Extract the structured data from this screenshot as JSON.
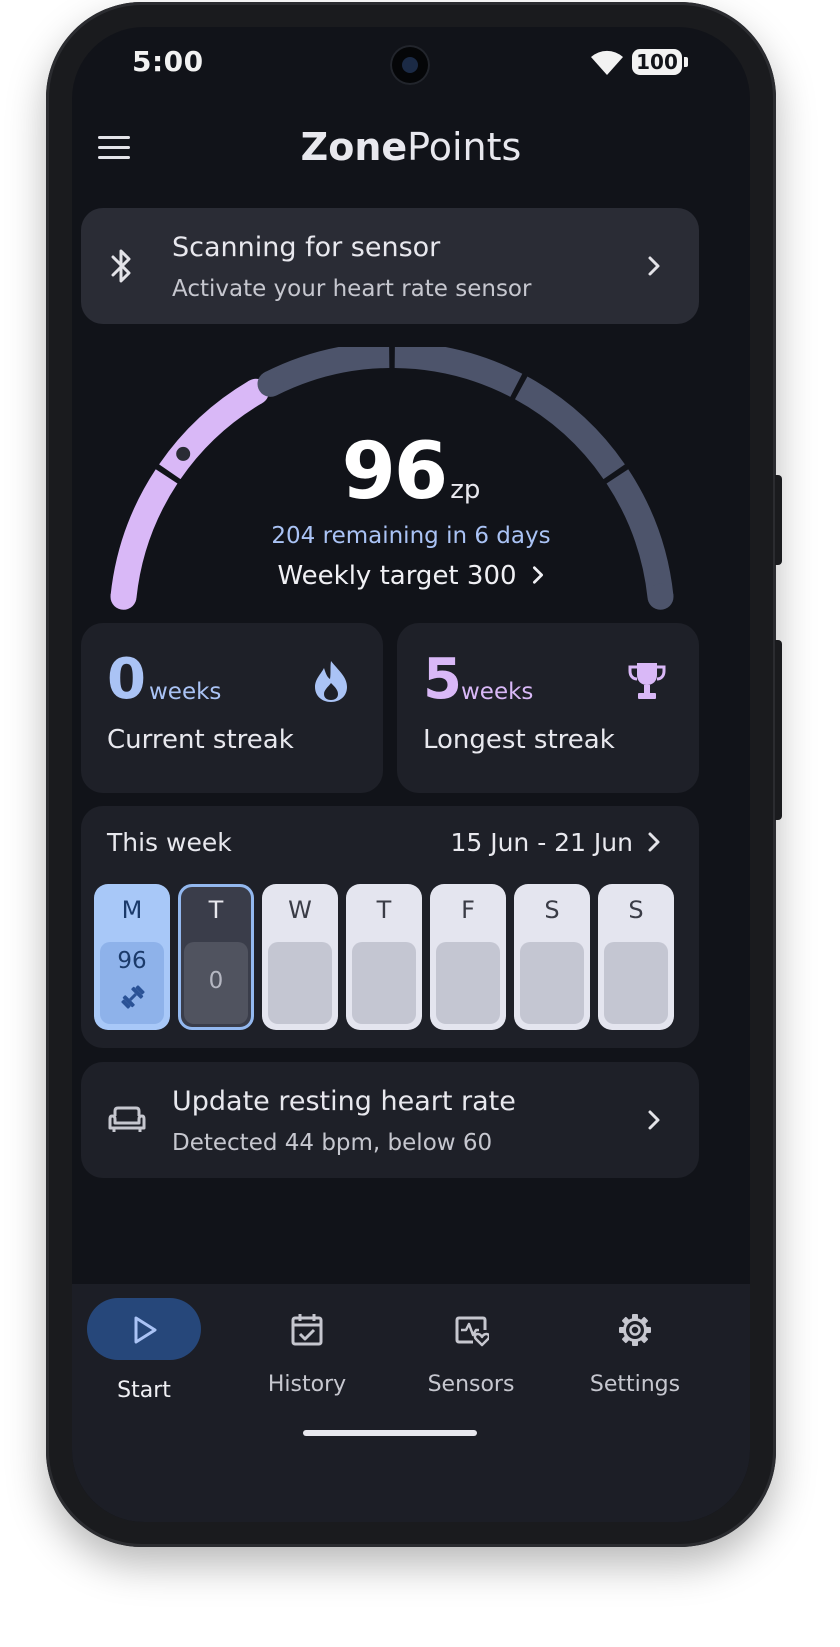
{
  "status_bar": {
    "time": "5:00",
    "battery": "100"
  },
  "app_bar": {
    "title_bold": "Zone",
    "title_regular": "Points",
    "menu_icon": "hamburger-menu-icon"
  },
  "sensor_banner": {
    "title": "Scanning for sensor",
    "subtitle": "Activate your heart rate sensor",
    "icon": "bluetooth-icon"
  },
  "gauge": {
    "value": "96",
    "unit": "zp",
    "remaining": "204 remaining in 6 days",
    "target_label": "Weekly target 300",
    "progress": 0.32,
    "accent_color": "#d9b8f7",
    "track_color": "#4d546b"
  },
  "streaks": {
    "current": {
      "value": "0",
      "unit": "weeks",
      "label": "Current streak",
      "icon": "flame-icon",
      "color": "#aac3f5"
    },
    "longest": {
      "value": "5",
      "unit": "weeks",
      "label": "Longest streak",
      "icon": "trophy-icon",
      "color": "#d9b8f7"
    }
  },
  "week": {
    "title": "This week",
    "range": "15 Jun - 21 Jun",
    "days": [
      {
        "letter": "M",
        "value": "96",
        "state": "done",
        "icon": "dumbbell-icon"
      },
      {
        "letter": "T",
        "value": "0",
        "state": "today"
      },
      {
        "letter": "W",
        "value": "",
        "state": "future"
      },
      {
        "letter": "T",
        "value": "",
        "state": "future"
      },
      {
        "letter": "F",
        "value": "",
        "state": "future"
      },
      {
        "letter": "S",
        "value": "",
        "state": "future"
      },
      {
        "letter": "S",
        "value": "",
        "state": "future"
      }
    ]
  },
  "resting_hr": {
    "title": "Update resting heart rate",
    "subtitle": "Detected 44 bpm, below 60",
    "icon": "sofa-icon"
  },
  "nav": {
    "items": [
      {
        "label": "Start",
        "icon": "play-icon",
        "active": true
      },
      {
        "label": "History",
        "icon": "calendar-check-icon",
        "active": false
      },
      {
        "label": "Sensors",
        "icon": "heart-monitor-icon",
        "active": false
      },
      {
        "label": "Settings",
        "icon": "gear-icon",
        "active": false
      }
    ]
  }
}
